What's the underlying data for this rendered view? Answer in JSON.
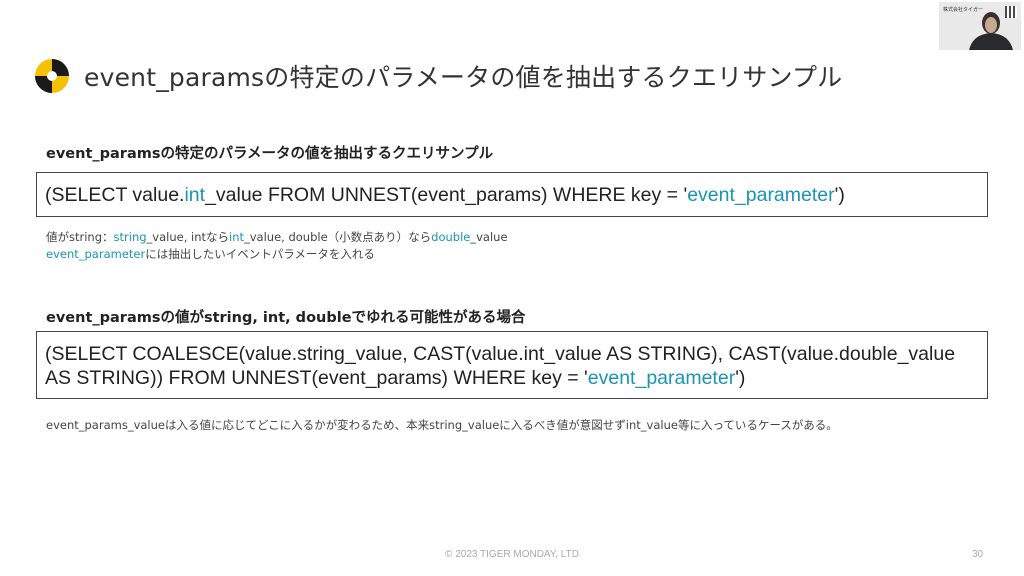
{
  "slide": {
    "title": "event_paramsの特定のパラメータの値を抽出するクエリサンプル",
    "footer": "© 2023 TIGER MONDAY, LTD",
    "page_number": "30"
  },
  "section1": {
    "heading": "event_paramsの特定のパラメータの値を抽出するクエリサンプル",
    "code": {
      "p1": "(SELECT value.",
      "p2": "int",
      "p3": "_value FROM UNNEST(event_params) WHERE key = '",
      "p4": "event_parameter",
      "p5": "')"
    },
    "note1": {
      "p1": "値がstring：",
      "p2": "string",
      "p3": "_value, intなら",
      "p4": "int",
      "p5": "_value, double（小数点あり）なら",
      "p6": "double",
      "p7": "_value"
    },
    "note2": {
      "p1": "event_parameter",
      "p2": "には抽出したいイベントパラメータを入れる"
    }
  },
  "section2": {
    "heading": "event_paramsの値がstring, int, doubleでゆれる可能性がある場合",
    "code": {
      "line1": "(SELECT COALESCE(value.string_value, CAST(value.int_value AS STRING), CAST(value.double_value",
      "line2_p1": "AS STRING)) FROM UNNEST(event_params) WHERE key = '",
      "line2_p2": "event_parameter",
      "line2_p3": "')"
    },
    "note": "event_params_valueは入る値に応じてどこに入るかが変わるため、本来string_valueに入るべき値が意図せずint_value等に入っているケースがある。"
  },
  "webcam": {
    "label": "株式会社タイガー"
  },
  "colors": {
    "accent": "#1a95b0",
    "logo_yellow": "#f5c000",
    "text": "#222222"
  }
}
